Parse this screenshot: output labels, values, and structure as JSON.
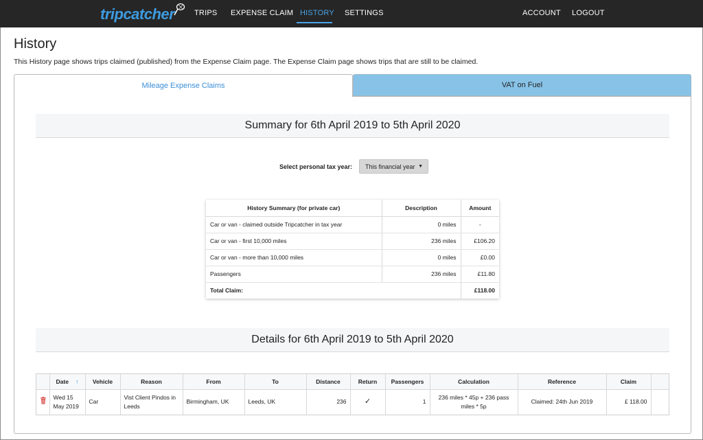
{
  "nav": {
    "logo_text": "tripcatcher",
    "items": [
      "TRIPS",
      "EXPENSE CLAIM",
      "HISTORY",
      "SETTINGS"
    ],
    "active": "HISTORY",
    "right_items": [
      "ACCOUNT",
      "LOGOUT"
    ]
  },
  "header": {
    "title": "History",
    "description": "This History page shows trips claimed (published) from the Expense Claim page. The Expense Claim page shows trips that are still to be claimed."
  },
  "tabs": [
    {
      "label": "Mileage Expense Claims",
      "active": true
    },
    {
      "label": "VAT on Fuel",
      "active": false
    }
  ],
  "summary": {
    "heading": "Summary for 6th April 2019 to 5th April 2020",
    "select_label": "Select personal tax year:",
    "select_value": "This financial year",
    "columns": [
      "History Summary (for private car)",
      "Description",
      "Amount"
    ],
    "rows": [
      [
        "Car or van - claimed outside Tripcatcher in tax year",
        "0 miles",
        "-"
      ],
      [
        "Car or van - first 10,000 miles",
        "236 miles",
        "£106.20"
      ],
      [
        "Car or van - more than 10,000 miles",
        "0 miles",
        "£0.00"
      ],
      [
        "Passengers",
        "236 miles",
        "£11.80"
      ]
    ],
    "total_label": "Total Claim:",
    "total_value": "£118.00"
  },
  "details": {
    "heading": "Details for 6th April 2019 to 5th April 2020",
    "columns": [
      "",
      "Date",
      "Vehicle",
      "Reason",
      "From",
      "To",
      "Distance",
      "Return",
      "Passengers",
      "Calculation",
      "Reference",
      "Claim"
    ],
    "rows": [
      {
        "date": "Wed 15 May 2019",
        "vehicle": "Car",
        "reason": "Vist Client Pindos in Leeds",
        "from": "Birmingham, UK",
        "to": "Leeds, UK",
        "distance": "236",
        "return": "✓",
        "passengers": "1",
        "calculation": "236 miles * 45p + 236 pass miles * 5p",
        "reference": "Claimed: 24th Jun 2019",
        "claim": "£ 118.00"
      }
    ]
  },
  "colors": {
    "nav_bg": "#262626",
    "accent": "#4aa3e8",
    "tab_inactive_bg": "#88c3e7",
    "trash": "#d9534f"
  }
}
